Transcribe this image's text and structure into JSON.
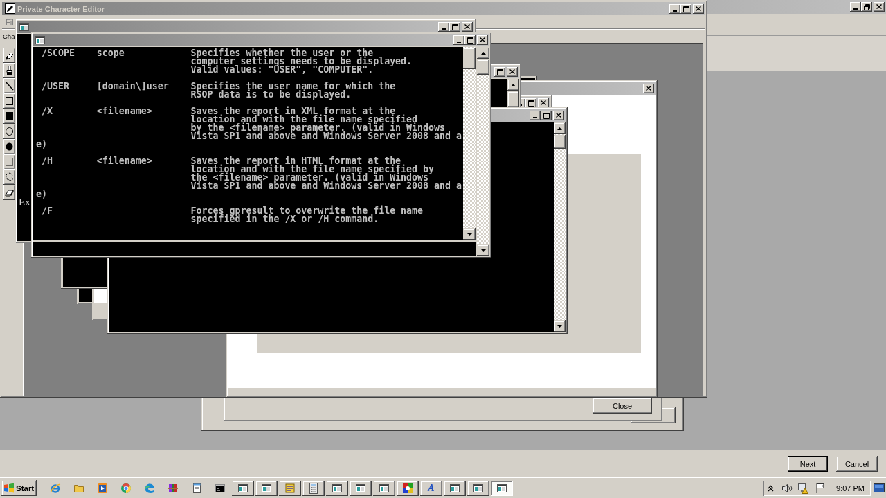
{
  "editor": {
    "title": "Private Character Editor",
    "menu": [
      "Fil"
    ],
    "toolbar_label": "Cha"
  },
  "console_behind": {
    "lines": [
      "Ex"
    ]
  },
  "console_front": {
    "entries": [
      {
        "option": "/SCOPE",
        "argument": "scope",
        "description": "Specifies whether the user or the\ncomputer settings needs to be displayed.\nValid values: \"USER\", \"COMPUTER\"."
      },
      {
        "option": "/USER",
        "argument": "[domain\\]user",
        "description": "Specifies the user name for which the\nRSOP data is to be displayed."
      },
      {
        "option": "/X",
        "argument": "<filename>",
        "description": "Saves the report in XML format at the\nlocation and with the file name specified\nby the <filename> parameter. (valid in Windows\nVista SP1 and above and Windows Server 2008 and a",
        "wrap": "e)"
      },
      {
        "option": "/H",
        "argument": "<filename>",
        "description": "Saves the report in HTML format at the\nlocation and with the file name specified by\nthe <filename> parameter. (valid in Windows\nVista SP1 and above and Windows Server 2008 and a",
        "wrap": "e)"
      },
      {
        "option": "/F",
        "description": "Forces gpresult to overwrite the file name\nspecified in the /X or /H command."
      }
    ]
  },
  "dialog": {
    "buttons": [
      {
        "label": "Close",
        "default": false
      }
    ]
  },
  "wizard": {
    "buttons": [
      {
        "label": "Next",
        "default": true
      },
      {
        "label": "Cancel",
        "default": false
      }
    ]
  },
  "taskbar": {
    "start": "Start",
    "tasks": [
      {
        "kind": "window",
        "selected": false
      },
      {
        "kind": "window",
        "selected": false
      },
      {
        "kind": "tool",
        "selected": false
      },
      {
        "kind": "calculator",
        "selected": false
      },
      {
        "kind": "window",
        "selected": false
      },
      {
        "kind": "window",
        "selected": false
      },
      {
        "kind": "window",
        "selected": false
      },
      {
        "kind": "mosaic",
        "selected": false
      },
      {
        "kind": "font",
        "glyph": "A",
        "selected": false
      },
      {
        "kind": "window",
        "selected": false
      },
      {
        "kind": "window",
        "selected": false
      },
      {
        "kind": "window",
        "selected": true
      }
    ],
    "clock": "9:07 PM"
  }
}
